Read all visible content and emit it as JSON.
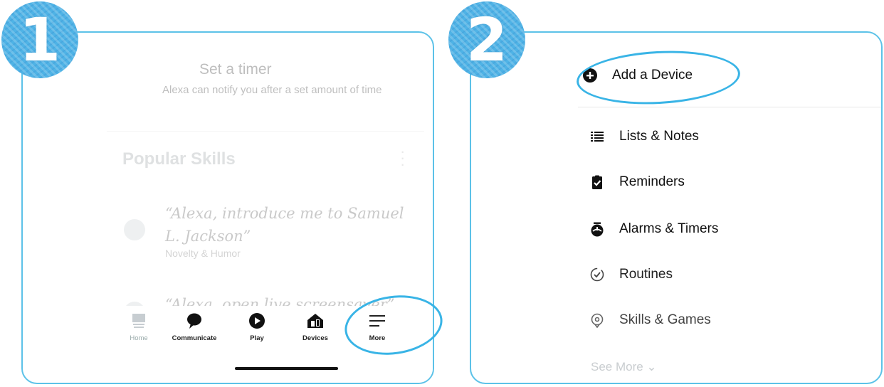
{
  "badges": {
    "step1": "1",
    "step2": "2"
  },
  "colors": {
    "accent": "#4fb3e6",
    "panel_border": "#5cc2e8",
    "ellipse": "#39b4e6"
  },
  "panel1": {
    "timer_title": "Set a timer",
    "timer_desc": "Alexa can notify you after a set amount of time",
    "popular_title": "Popular Skills",
    "skills": [
      {
        "quote": "“Alexa, introduce me to Samuel L. Jackson”",
        "category": "Novelty & Humor"
      },
      {
        "quote": "“Alexa, open live screensaver”"
      }
    ],
    "nav": [
      {
        "label": "Home",
        "icon": "home-icon"
      },
      {
        "label": "Communicate",
        "icon": "chat-bubble-icon"
      },
      {
        "label": "Play",
        "icon": "play-icon"
      },
      {
        "label": "Devices",
        "icon": "devices-icon"
      },
      {
        "label": "More",
        "icon": "hamburger-icon"
      }
    ]
  },
  "panel2": {
    "menu": [
      {
        "label": "Add a Device",
        "icon": "plus-circle-icon"
      },
      {
        "label": "Lists & Notes",
        "icon": "list-icon"
      },
      {
        "label": "Reminders",
        "icon": "clipboard-check-icon"
      },
      {
        "label": "Alarms & Timers",
        "icon": "alarm-clock-icon"
      },
      {
        "label": "Routines",
        "icon": "routines-check-icon"
      },
      {
        "label": "Skills & Games",
        "icon": "skills-pin-icon"
      }
    ],
    "see_more": "See More ⌄"
  }
}
